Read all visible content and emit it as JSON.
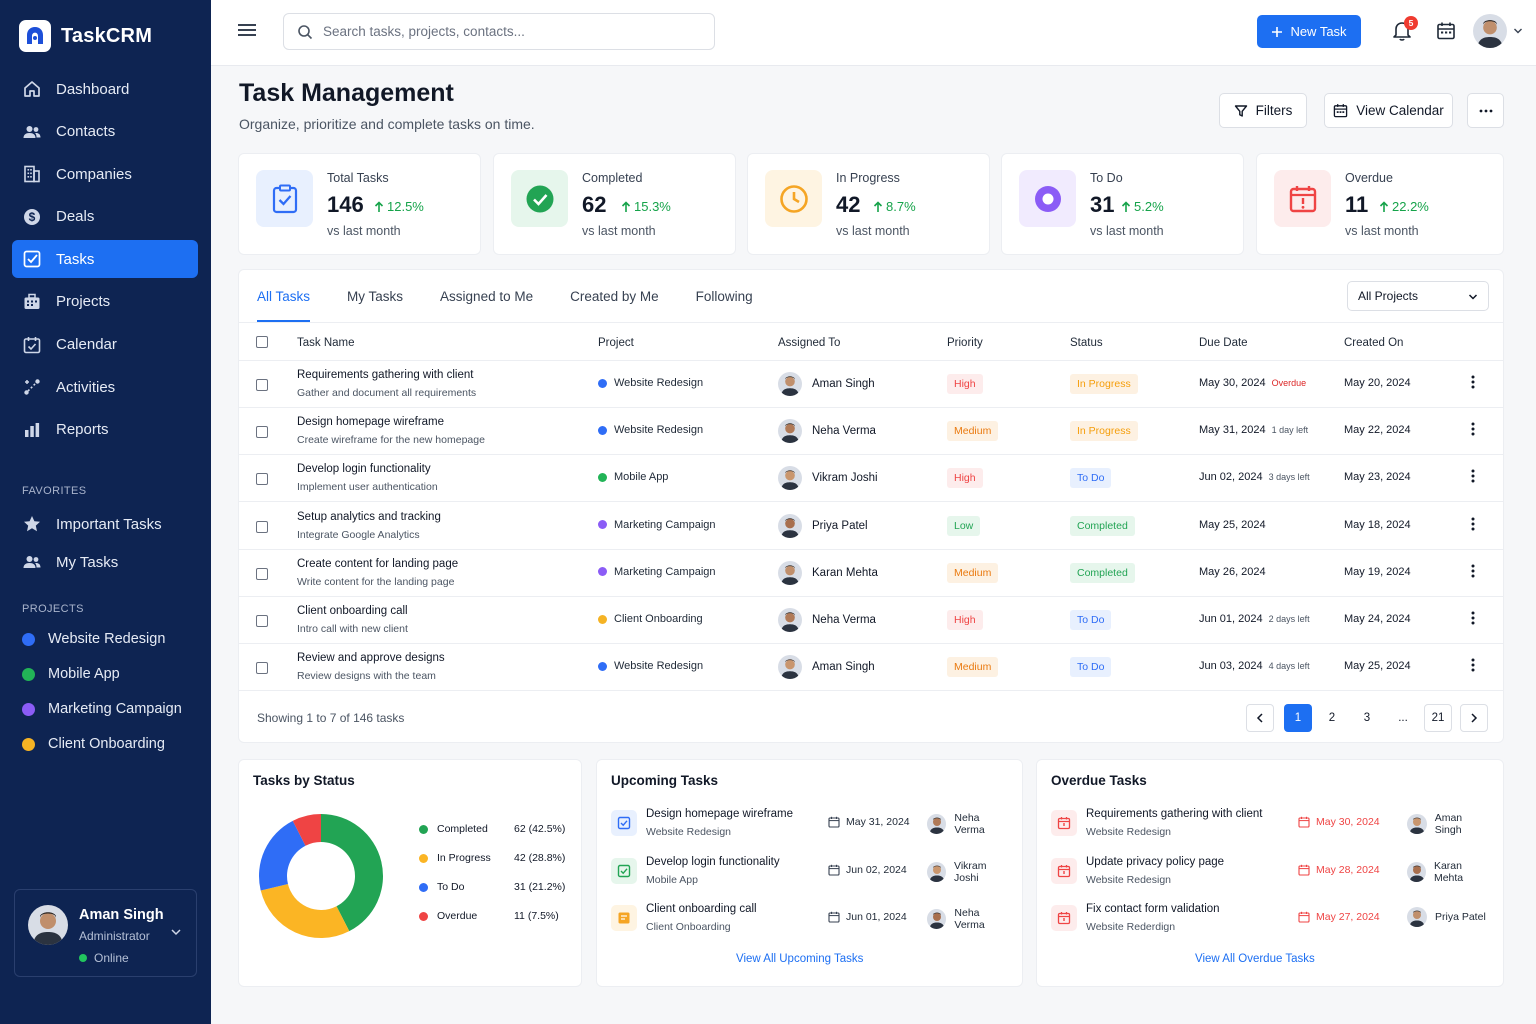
{
  "app": {
    "name": "TaskCRM"
  },
  "sidebar": {
    "nav": [
      {
        "label": "Dashboard",
        "icon": "home-icon"
      },
      {
        "label": "Contacts",
        "icon": "users-icon"
      },
      {
        "label": "Companies",
        "icon": "building-icon"
      },
      {
        "label": "Deals",
        "icon": "dollar-icon"
      },
      {
        "label": "Tasks",
        "icon": "check-square-icon",
        "active": true
      },
      {
        "label": "Projects",
        "icon": "briefcase-icon"
      },
      {
        "label": "Calendar",
        "icon": "calendar-icon"
      },
      {
        "label": "Activities",
        "icon": "activity-icon"
      },
      {
        "label": "Reports",
        "icon": "bar-chart-icon"
      }
    ],
    "favorites_title": "FAVORITES",
    "favorites": [
      {
        "label": "Important Tasks",
        "icon": "star-icon"
      },
      {
        "label": "My Tasks",
        "icon": "users-icon"
      }
    ],
    "projects_title": "PROJECTS",
    "projects": [
      {
        "label": "Website Redesign",
        "color": "#2f6df6"
      },
      {
        "label": "Mobile App",
        "color": "#22b457"
      },
      {
        "label": "Marketing Campaign",
        "color": "#8b5cf6"
      },
      {
        "label": "Client Onboarding",
        "color": "#f5b324"
      }
    ],
    "user": {
      "name": "Aman Singh",
      "role": "Administrator",
      "status": "Online"
    }
  },
  "topbar": {
    "search_placeholder": "Search tasks, projects, contacts...",
    "new_task_label": "New Task",
    "notification_count": "5"
  },
  "header": {
    "title": "Task Management",
    "subtitle": "Organize, prioritize and complete tasks on time.",
    "filters_label": "Filters",
    "view_calendar_label": "View Calendar"
  },
  "stats": [
    {
      "label": "Total Tasks",
      "value": "146",
      "change": "12.5%",
      "sub": "vs last month",
      "icon": "clipboard-check-icon",
      "color": "#2f6df6",
      "bg": "#e8f0fe"
    },
    {
      "label": "Completed",
      "value": "62",
      "change": "15.3%",
      "sub": "vs last month",
      "icon": "check-circle-icon",
      "color": "#22a454",
      "bg": "#e6f6ec"
    },
    {
      "label": "In Progress",
      "value": "42",
      "change": "8.7%",
      "sub": "vs last month",
      "icon": "clock-icon",
      "color": "#f5a524",
      "bg": "#fef4e2"
    },
    {
      "label": "To Do",
      "value": "31",
      "change": "5.2%",
      "sub": "vs last month",
      "icon": "record-icon",
      "color": "#8b5cf6",
      "bg": "#f1ebfe"
    },
    {
      "label": "Overdue",
      "value": "11",
      "change": "22.2%",
      "sub": "vs last month",
      "icon": "calendar-alert-icon",
      "color": "#ef4444",
      "bg": "#fdecec"
    }
  ],
  "tabs": [
    "All Tasks",
    "My Tasks",
    "Assigned to Me",
    "Created by Me",
    "Following"
  ],
  "project_filter": "All Projects",
  "table": {
    "columns": [
      "Task Name",
      "Project",
      "Assigned To",
      "Priority",
      "Status",
      "Due Date",
      "Created On"
    ],
    "rows": [
      {
        "name": "Requirements gathering with client",
        "desc": "Gather and document all requirements",
        "project": "Website Redesign",
        "project_color": "#2f6df6",
        "assignee": "Aman Singh",
        "priority": "High",
        "status": "In Progress",
        "due": "May 30, 2024",
        "due_note": "Overdue",
        "created": "May 20, 2024"
      },
      {
        "name": "Design homepage wireframe",
        "desc": "Create wireframe for the new homepage",
        "project": "Website Redesign",
        "project_color": "#2f6df6",
        "assignee": "Neha Verma",
        "priority": "Medium",
        "status": "In Progress",
        "due": "May 31, 2024",
        "due_note": "1 day left",
        "created": "May 22, 2024"
      },
      {
        "name": "Develop login functionality",
        "desc": "Implement user authentication",
        "project": "Mobile App",
        "project_color": "#22b457",
        "assignee": "Vikram Joshi",
        "priority": "High",
        "status": "To Do",
        "due": "Jun 02, 2024",
        "due_note": "3 days left",
        "created": "May 23, 2024"
      },
      {
        "name": "Setup analytics and tracking",
        "desc": "Integrate Google Analytics",
        "project": "Marketing Campaign",
        "project_color": "#8b5cf6",
        "assignee": "Priya Patel",
        "priority": "Low",
        "status": "Completed",
        "due": "May 25, 2024",
        "due_note": "",
        "created": "May 18, 2024"
      },
      {
        "name": "Create content for landing page",
        "desc": "Write content for the landing page",
        "project": "Marketing Campaign",
        "project_color": "#8b5cf6",
        "assignee": "Karan Mehta",
        "priority": "Medium",
        "status": "Completed",
        "due": "May 26, 2024",
        "due_note": "",
        "created": "May 19, 2024"
      },
      {
        "name": "Client onboarding call",
        "desc": "Intro call with new client",
        "project": "Client Onboarding",
        "project_color": "#f5b324",
        "assignee": "Neha Verma",
        "priority": "High",
        "status": "To Do",
        "due": "Jun 01, 2024",
        "due_note": "2 days left",
        "created": "May 24, 2024"
      },
      {
        "name": "Review and approve designs",
        "desc": "Review designs with the team",
        "project": "Website Redesign",
        "project_color": "#2f6df6",
        "assignee": "Aman Singh",
        "priority": "Medium",
        "status": "To Do",
        "due": "Jun 03, 2024",
        "due_note": "4 days left",
        "created": "May 25, 2024"
      }
    ],
    "showing": "Showing 1 to 7 of 146 tasks",
    "pages": [
      "1",
      "2",
      "3",
      "...",
      "21"
    ]
  },
  "status_card": {
    "title": "Tasks by Status",
    "items": [
      {
        "label": "Completed",
        "value": 62,
        "display": "62 (42.5%)",
        "color": "#22a454"
      },
      {
        "label": "In Progress",
        "value": 42,
        "display": "42 (28.8%)",
        "color": "#fbb524"
      },
      {
        "label": "To Do",
        "value": 31,
        "display": "31 (21.2%)",
        "color": "#2f6df6"
      },
      {
        "label": "Overdue",
        "value": 11,
        "display": "11 (7.5%)",
        "color": "#ef4444"
      }
    ]
  },
  "upcoming": {
    "title": "Upcoming Tasks",
    "items": [
      {
        "title": "Design homepage wireframe",
        "project": "Website Redesign",
        "date": "May 31, 2024",
        "assignee": "Neha Verma",
        "icon": "check-square-icon",
        "color": "#2f6df6",
        "bg": "#e8f0fe"
      },
      {
        "title": "Develop login functionality",
        "project": "Mobile App",
        "date": "Jun 02, 2024",
        "assignee": "Vikram Joshi",
        "icon": "check-square-icon",
        "color": "#22a454",
        "bg": "#e6f6ec"
      },
      {
        "title": "Client onboarding call",
        "project": "Client Onboarding",
        "date": "Jun 01, 2024",
        "assignee": "Neha Verma",
        "icon": "note-icon",
        "color": "#f5a524",
        "bg": "#fef4e2"
      }
    ],
    "link": "View All Upcoming Tasks"
  },
  "overdue": {
    "title": "Overdue Tasks",
    "items": [
      {
        "title": "Requirements gathering with client",
        "project": "Website Redesign",
        "date": "May 30, 2024",
        "assignee": "Aman Singh"
      },
      {
        "title": "Update privacy policy page",
        "project": "Website Redesign",
        "date": "May 28, 2024",
        "assignee": "Karan Mehta"
      },
      {
        "title": "Fix contact form validation",
        "project": "Website Rederdign",
        "date": "May 27, 2024",
        "assignee": "Priya Patel"
      }
    ],
    "link": "View All Overdue Tasks"
  }
}
